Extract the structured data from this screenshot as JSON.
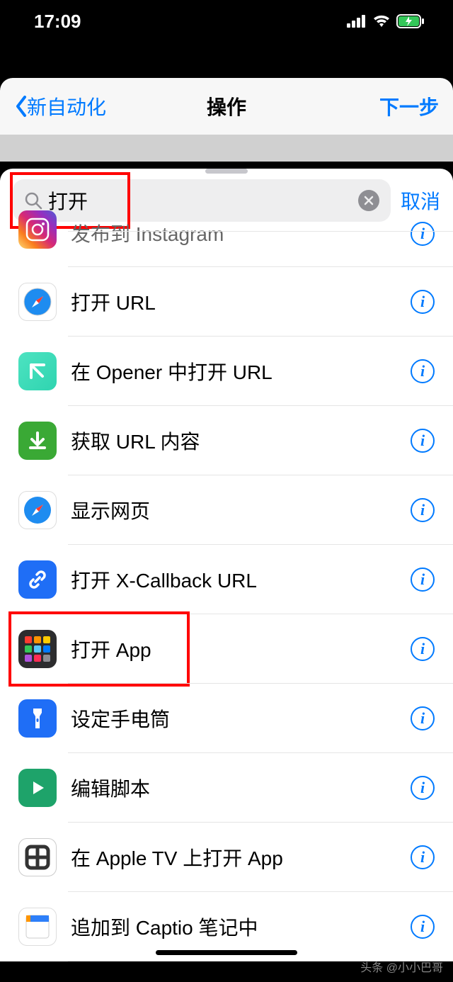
{
  "status": {
    "time": "17:09"
  },
  "nav": {
    "back": "新自动化",
    "title": "操作",
    "next": "下一步"
  },
  "search": {
    "value": "打开",
    "cancel": "取消"
  },
  "rows": {
    "instagram": "发布到 Instagram",
    "openurl": "打开 URL",
    "opener": "在 Opener 中打开 URL",
    "geturl": "获取 URL 内容",
    "showweb": "显示网页",
    "xcallback": "打开 X-Callback URL",
    "openapp": "打开 App",
    "flashlight": "设定手电筒",
    "script": "编辑脚本",
    "appletv": "在 Apple TV 上打开 App",
    "captio": "追加到 Captio 笔记中"
  },
  "watermark": "头条 @小小巴哥"
}
